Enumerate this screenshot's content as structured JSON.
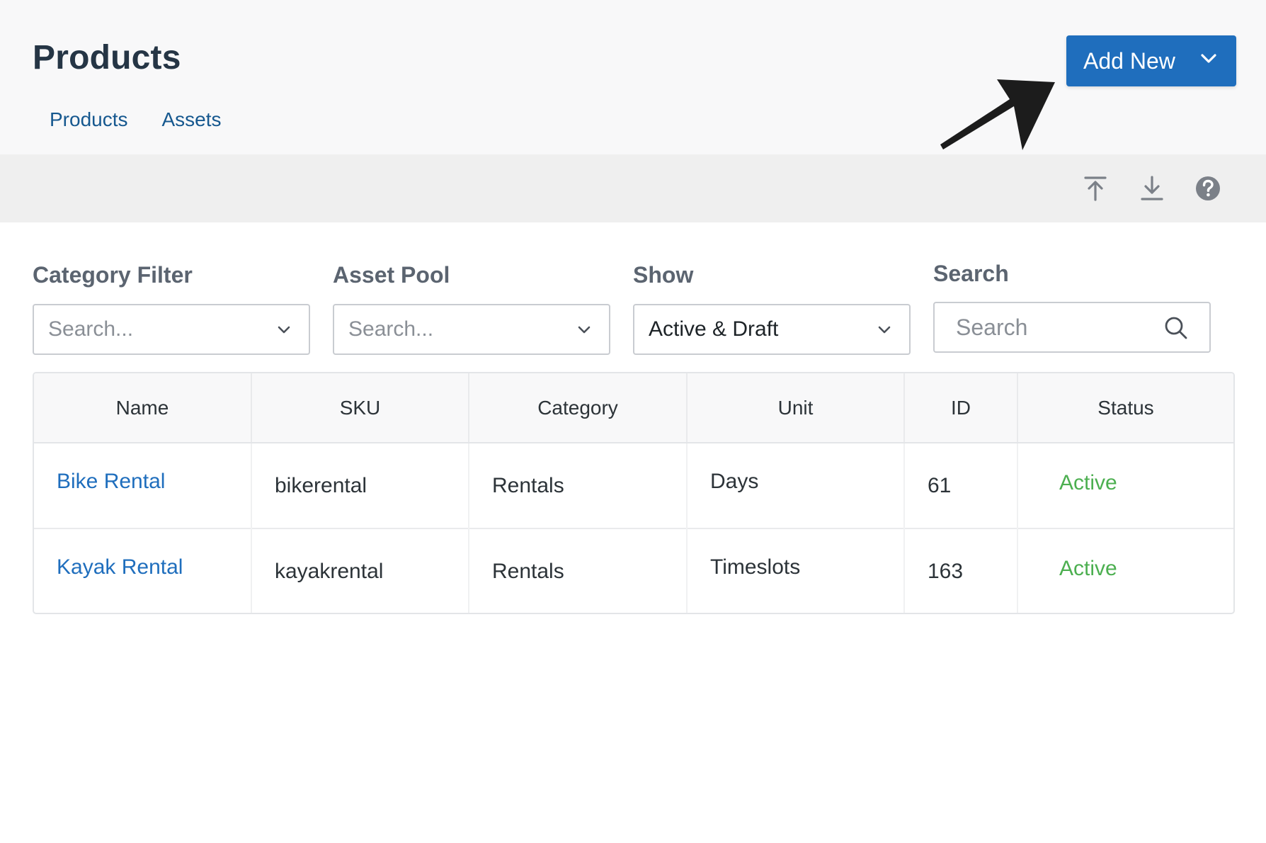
{
  "header": {
    "title": "Products",
    "tabs": [
      {
        "label": "Products"
      },
      {
        "label": "Assets"
      }
    ],
    "add_new_label": "Add New"
  },
  "toolbar": {
    "icons": [
      "upload-icon",
      "download-icon",
      "help-icon"
    ]
  },
  "filters": {
    "category": {
      "label": "Category Filter",
      "placeholder": "Search..."
    },
    "asset_pool": {
      "label": "Asset Pool",
      "placeholder": "Search..."
    },
    "show": {
      "label": "Show",
      "value": "Active & Draft"
    },
    "search": {
      "label": "Search",
      "placeholder": "Search"
    }
  },
  "table": {
    "columns": [
      "Name",
      "SKU",
      "Category",
      "Unit",
      "ID",
      "Status"
    ],
    "rows": [
      {
        "name": "Bike Rental",
        "sku": "bikerental",
        "category": "Rentals",
        "unit": "Days",
        "id": "61",
        "status": "Active"
      },
      {
        "name": "Kayak Rental",
        "sku": "kayakrental",
        "category": "Rentals",
        "unit": "Timeslots",
        "id": "163",
        "status": "Active"
      }
    ]
  },
  "colors": {
    "primary": "#1f6ebd",
    "link": "#16588f",
    "status_active": "#4caf50",
    "title": "#253545"
  }
}
